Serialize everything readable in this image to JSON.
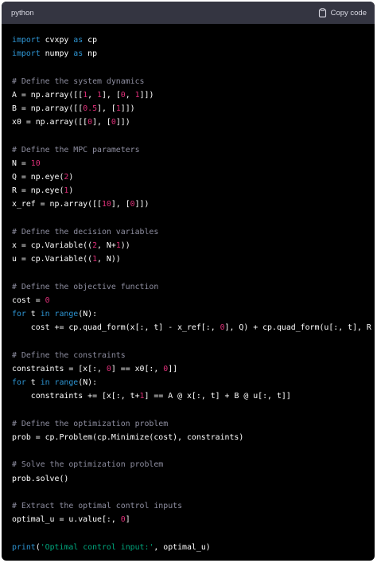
{
  "header": {
    "language": "python",
    "copy_label": "Copy code",
    "copy_icon": "clipboard-icon"
  },
  "code_lines": [
    [
      {
        "t": "import",
        "c": "kw"
      },
      {
        "t": " cvxpy "
      },
      {
        "t": "as",
        "c": "kw"
      },
      {
        "t": " cp"
      }
    ],
    [
      {
        "t": "import",
        "c": "kw"
      },
      {
        "t": " numpy "
      },
      {
        "t": "as",
        "c": "kw"
      },
      {
        "t": " np"
      }
    ],
    [],
    [
      {
        "t": "# Define the system dynamics",
        "c": "cm"
      }
    ],
    [
      {
        "t": "A = np.array([["
      },
      {
        "t": "1",
        "c": "nm"
      },
      {
        "t": ", "
      },
      {
        "t": "1",
        "c": "nm"
      },
      {
        "t": "], ["
      },
      {
        "t": "0",
        "c": "nm"
      },
      {
        "t": ", "
      },
      {
        "t": "1",
        "c": "nm"
      },
      {
        "t": "]])"
      }
    ],
    [
      {
        "t": "B = np.array([["
      },
      {
        "t": "0.5",
        "c": "nm"
      },
      {
        "t": "], ["
      },
      {
        "t": "1",
        "c": "nm"
      },
      {
        "t": "]])"
      }
    ],
    [
      {
        "t": "x0 = np.array([["
      },
      {
        "t": "0",
        "c": "nm"
      },
      {
        "t": "], ["
      },
      {
        "t": "0",
        "c": "nm"
      },
      {
        "t": "]])"
      }
    ],
    [],
    [
      {
        "t": "# Define the MPC parameters",
        "c": "cm"
      }
    ],
    [
      {
        "t": "N = "
      },
      {
        "t": "10",
        "c": "nm"
      }
    ],
    [
      {
        "t": "Q = np.eye("
      },
      {
        "t": "2",
        "c": "nm"
      },
      {
        "t": ")"
      }
    ],
    [
      {
        "t": "R = np.eye("
      },
      {
        "t": "1",
        "c": "nm"
      },
      {
        "t": ")"
      }
    ],
    [
      {
        "t": "x_ref = np.array([["
      },
      {
        "t": "10",
        "c": "nm"
      },
      {
        "t": "], ["
      },
      {
        "t": "0",
        "c": "nm"
      },
      {
        "t": "]])"
      }
    ],
    [],
    [
      {
        "t": "# Define the decision variables",
        "c": "cm"
      }
    ],
    [
      {
        "t": "x = cp.Variable(("
      },
      {
        "t": "2",
        "c": "nm"
      },
      {
        "t": ", N+"
      },
      {
        "t": "1",
        "c": "nm"
      },
      {
        "t": "))"
      }
    ],
    [
      {
        "t": "u = cp.Variable(("
      },
      {
        "t": "1",
        "c": "nm"
      },
      {
        "t": ", N))"
      }
    ],
    [],
    [
      {
        "t": "# Define the objective function",
        "c": "cm"
      }
    ],
    [
      {
        "t": "cost = "
      },
      {
        "t": "0",
        "c": "nm"
      }
    ],
    [
      {
        "t": "for",
        "c": "kw"
      },
      {
        "t": " t "
      },
      {
        "t": "in",
        "c": "kw"
      },
      {
        "t": " "
      },
      {
        "t": "range",
        "c": "kw"
      },
      {
        "t": "(N):"
      }
    ],
    [
      {
        "t": "    cost += cp.quad_form(x[:, t] - x_ref[:, "
      },
      {
        "t": "0",
        "c": "nm"
      },
      {
        "t": "], Q) + cp.quad_form(u[:, t], R"
      }
    ],
    [],
    [
      {
        "t": "# Define the constraints",
        "c": "cm"
      }
    ],
    [
      {
        "t": "constraints = [x[:, "
      },
      {
        "t": "0",
        "c": "nm"
      },
      {
        "t": "] == x0[:, "
      },
      {
        "t": "0",
        "c": "nm"
      },
      {
        "t": "]]"
      }
    ],
    [
      {
        "t": "for",
        "c": "kw"
      },
      {
        "t": " t "
      },
      {
        "t": "in",
        "c": "kw"
      },
      {
        "t": " "
      },
      {
        "t": "range",
        "c": "kw"
      },
      {
        "t": "(N):"
      }
    ],
    [
      {
        "t": "    constraints += [x[:, t+"
      },
      {
        "t": "1",
        "c": "nm"
      },
      {
        "t": "] == A @ x[:, t] + B @ u[:, t]]"
      }
    ],
    [],
    [
      {
        "t": "# Define the optimization problem",
        "c": "cm"
      }
    ],
    [
      {
        "t": "prob = cp.Problem(cp.Minimize(cost), constraints)"
      }
    ],
    [],
    [
      {
        "t": "# Solve the optimization problem",
        "c": "cm"
      }
    ],
    [
      {
        "t": "prob.solve()"
      }
    ],
    [],
    [
      {
        "t": "# Extract the optimal control inputs",
        "c": "cm"
      }
    ],
    [
      {
        "t": "optimal_u = u.value[:, "
      },
      {
        "t": "0",
        "c": "nm"
      },
      {
        "t": "]"
      }
    ],
    [],
    [
      {
        "t": "print",
        "c": "kw"
      },
      {
        "t": "("
      },
      {
        "t": "'Optimal control input:'",
        "c": "st"
      },
      {
        "t": ", optimal_u)"
      }
    ]
  ]
}
